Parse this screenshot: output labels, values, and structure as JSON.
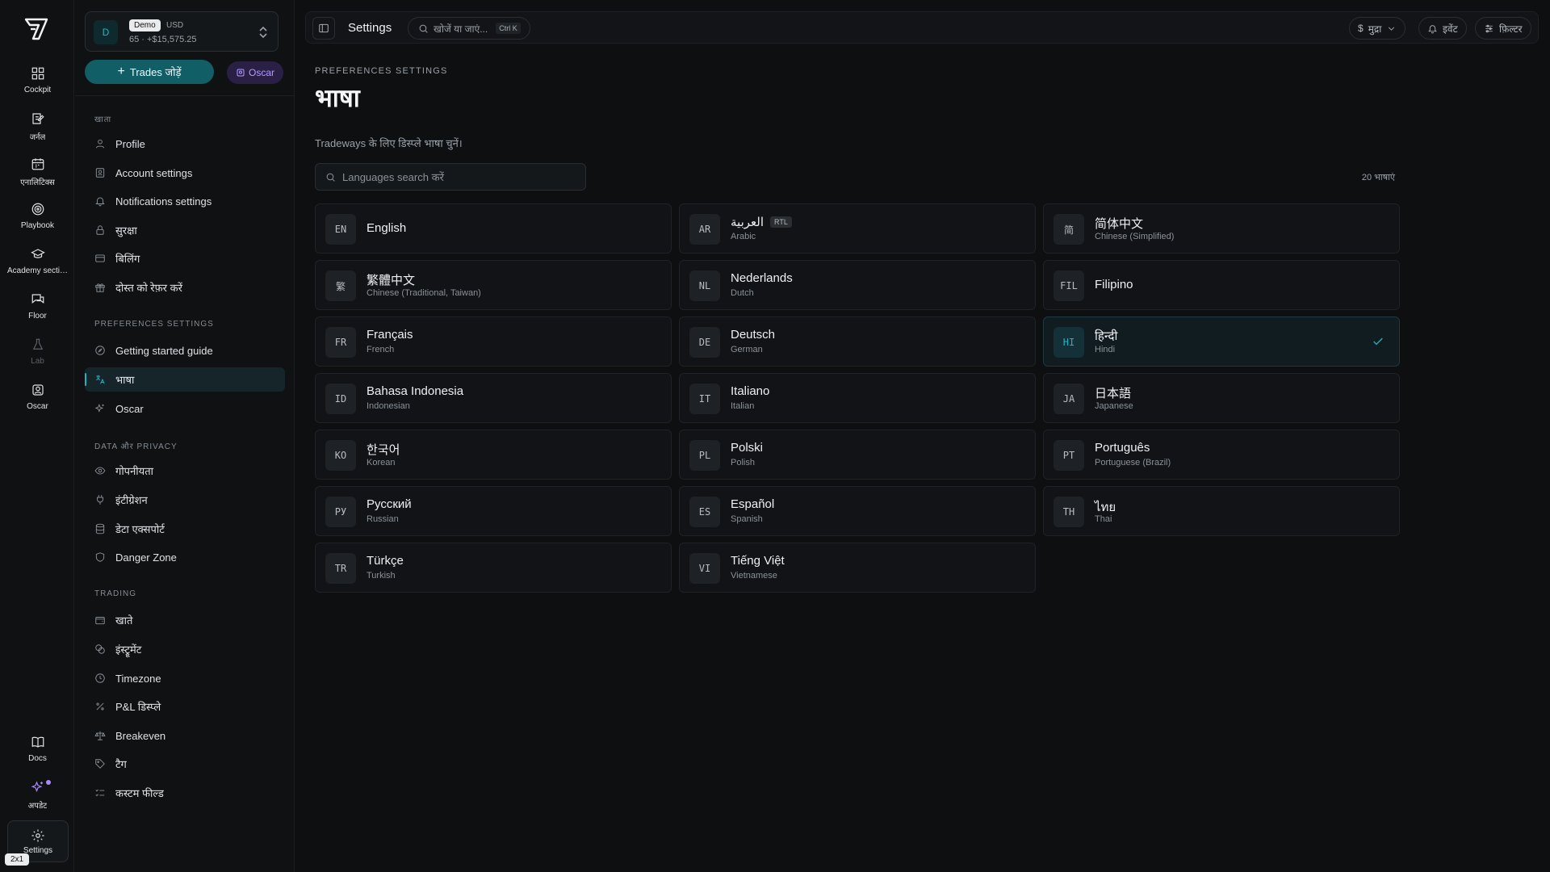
{
  "rail": {
    "items": [
      {
        "label": "Cockpit",
        "icon": "grid-icon"
      },
      {
        "label": "जर्नल",
        "icon": "journal-icon"
      },
      {
        "label": "एनालिटिक्स",
        "icon": "calendar-icon"
      },
      {
        "label": "Playbook",
        "icon": "target-icon"
      },
      {
        "label": "Academy secti…",
        "icon": "graduation-cap-icon"
      },
      {
        "label": "Floor",
        "icon": "chat-icon"
      },
      {
        "label": "Lab",
        "icon": "flask-icon"
      },
      {
        "label": "Oscar",
        "icon": "bot-icon"
      }
    ],
    "docs": "Docs",
    "updates": "अपडेट",
    "settings": "Settings",
    "zoom": "2x1"
  },
  "account": {
    "avatar": "D",
    "tag": "Demo",
    "currency": "USD",
    "balance": "65 · +$15,575.25"
  },
  "buttons": {
    "add_trades": "Trades जोड़ें",
    "oscar": "Oscar"
  },
  "sidebar": {
    "sections": {
      "account": "खाता",
      "preferences": "PREFERENCES SETTINGS",
      "data": "DATA और PRIVACY",
      "trading": "TRADING"
    },
    "account_items": [
      "Profile",
      "Account settings",
      "Notifications settings",
      "सुरक्षा",
      "बिलिंग",
      "दोस्त को रेफ़र करें"
    ],
    "preference_items": [
      "Getting started guide",
      "भाषा",
      "Oscar"
    ],
    "data_items": [
      "गोपनीयता",
      "इंटीग्रेशन",
      "डेटा एक्सपोर्ट",
      "Danger Zone"
    ],
    "trading_items": [
      "खाते",
      "इंस्ट्रूमेंट",
      "Timezone",
      "P&L डिस्प्ले",
      "Breakeven",
      "टैग",
      "कस्टम फील्ड"
    ]
  },
  "topbar": {
    "title": "Settings",
    "search": "खोजें या जाएं...",
    "shortcut": "Ctrl K",
    "currency": "मुद्रा",
    "events": "इवेंट",
    "filter": "फ़िल्टर"
  },
  "page": {
    "eyebrow": "PREFERENCES SETTINGS",
    "title": "भाषा",
    "description": "Tradeways के लिए डिस्प्ले भाषा चुनें।",
    "search_placeholder": "Languages search करें",
    "count": "20 भाषाएं",
    "accent": "#22b3c2"
  },
  "languages": [
    {
      "code": "EN",
      "name": "English",
      "sub": ""
    },
    {
      "code": "AR",
      "name": "العربية",
      "sub": "Arabic",
      "badge": "RTL"
    },
    {
      "code": "简",
      "name": "简体中文",
      "sub": "Chinese (Simplified)"
    },
    {
      "code": "繁",
      "name": "繁體中文",
      "sub": "Chinese (Traditional, Taiwan)"
    },
    {
      "code": "NL",
      "name": "Nederlands",
      "sub": "Dutch"
    },
    {
      "code": "FIL",
      "name": "Filipino",
      "sub": ""
    },
    {
      "code": "FR",
      "name": "Français",
      "sub": "French"
    },
    {
      "code": "DE",
      "name": "Deutsch",
      "sub": "German"
    },
    {
      "code": "HI",
      "name": "हिन्दी",
      "sub": "Hindi",
      "selected": true
    },
    {
      "code": "ID",
      "name": "Bahasa Indonesia",
      "sub": "Indonesian"
    },
    {
      "code": "IT",
      "name": "Italiano",
      "sub": "Italian"
    },
    {
      "code": "JA",
      "name": "日本語",
      "sub": "Japanese"
    },
    {
      "code": "KO",
      "name": "한국어",
      "sub": "Korean"
    },
    {
      "code": "PL",
      "name": "Polski",
      "sub": "Polish"
    },
    {
      "code": "PT",
      "name": "Português",
      "sub": "Portuguese (Brazil)"
    },
    {
      "code": "РУ",
      "name": "Русский",
      "sub": "Russian"
    },
    {
      "code": "ES",
      "name": "Español",
      "sub": "Spanish"
    },
    {
      "code": "TH",
      "name": "ไทย",
      "sub": "Thai"
    },
    {
      "code": "TR",
      "name": "Türkçe",
      "sub": "Turkish"
    },
    {
      "code": "VI",
      "name": "Tiếng Việt",
      "sub": "Vietnamese"
    }
  ]
}
